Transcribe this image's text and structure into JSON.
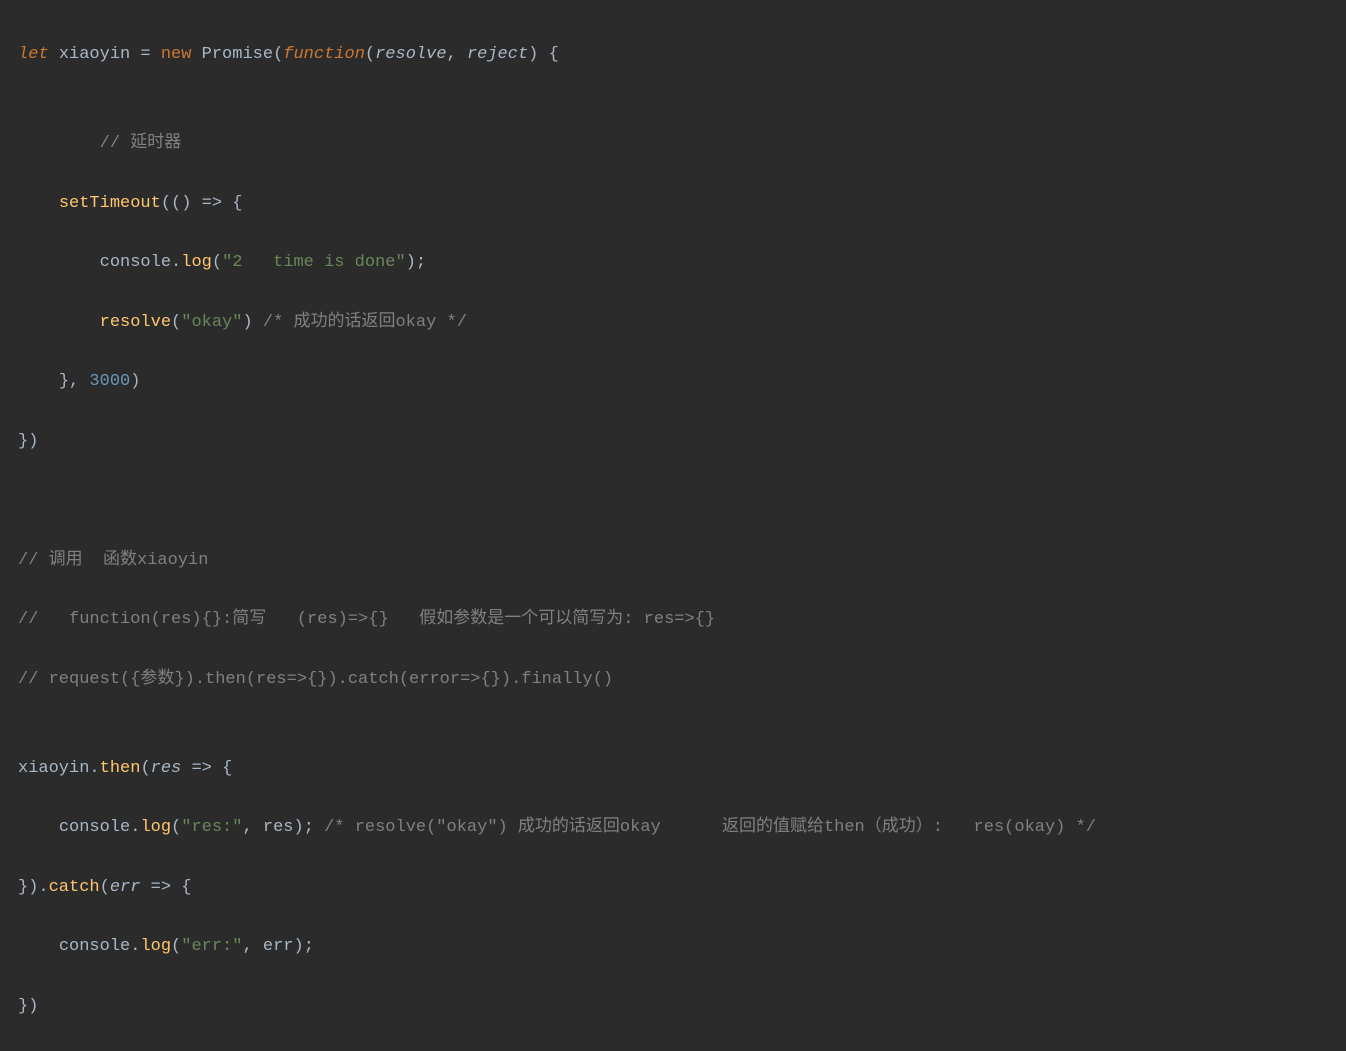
{
  "code": {
    "l1": {
      "let": "let ",
      "xiaoyin": "xiaoyin",
      "eq": " = ",
      "new": "new ",
      "Promise": "Promise",
      "op": "(",
      "function": "function",
      "op2": "(",
      "resolve": "resolve",
      "comma": ", ",
      "reject": "reject",
      "cp": ")",
      "sp": " ",
      "ob": "{"
    },
    "l2": {
      "empty": ""
    },
    "l3": {
      "indent": "        ",
      "comment": "// 延时器"
    },
    "l4": {
      "indent": "    ",
      "setTimeout": "setTimeout",
      "op": "(() ",
      "arrow": "=>",
      "sp": " ",
      "ob": "{"
    },
    "l5": {
      "indent": "        ",
      "console": "console",
      "dot": ".",
      "log": "log",
      "op": "(",
      "str": "\"2   time is done\"",
      "cp": ")",
      "semi": ";"
    },
    "l6": {
      "indent": "        ",
      "resolve": "resolve",
      "op": "(",
      "str": "\"okay\"",
      "cp": ")",
      "sp": " ",
      "comment": "/* 成功的话返回okay */"
    },
    "l7": {
      "indent": "    ",
      "cb": "}",
      "comma": ", ",
      "num": "3000",
      "cp": ")"
    },
    "l8": {
      "cb": "})"
    },
    "l9": {
      "empty": ""
    },
    "l10": {
      "empty": ""
    },
    "l11": {
      "comment": "// 调用  函数xiaoyin"
    },
    "l12": {
      "comment": "//   function(res){}:简写   (res)=>{}   假如参数是一个可以简写为: res=>{}"
    },
    "l13": {
      "comment": "// request({参数}).then(res=>{}).catch(error=>{}).finally()"
    },
    "l14": {
      "empty": ""
    },
    "l15": {
      "xiaoyin": "xiaoyin",
      "dot": ".",
      "then": "then",
      "op": "(",
      "res": "res",
      "sp": " ",
      "arrow": "=>",
      "sp2": " ",
      "ob": "{"
    },
    "l16": {
      "indent": "    ",
      "console": "console",
      "dot": ".",
      "log": "log",
      "op": "(",
      "str": "\"res:\"",
      "comma": ", ",
      "res": "res",
      "cp": ")",
      "semi": ";",
      "sp": " ",
      "comment": "/* resolve(\"okay\") 成功的话返回okay      返回的值赋给then（成功）:   res(okay) */"
    },
    "l17": {
      "cb": "})",
      "dot": ".",
      "catch": "catch",
      "op": "(",
      "err": "err",
      "sp": " ",
      "arrow": "=>",
      "sp2": " ",
      "ob": "{"
    },
    "l18": {
      "indent": "    ",
      "console": "console",
      "dot": ".",
      "log": "log",
      "op": "(",
      "str": "\"err:\"",
      "comma": ", ",
      "err": "err",
      "cp": ")",
      "semi": ";"
    },
    "l19": {
      "cb": "})"
    }
  }
}
